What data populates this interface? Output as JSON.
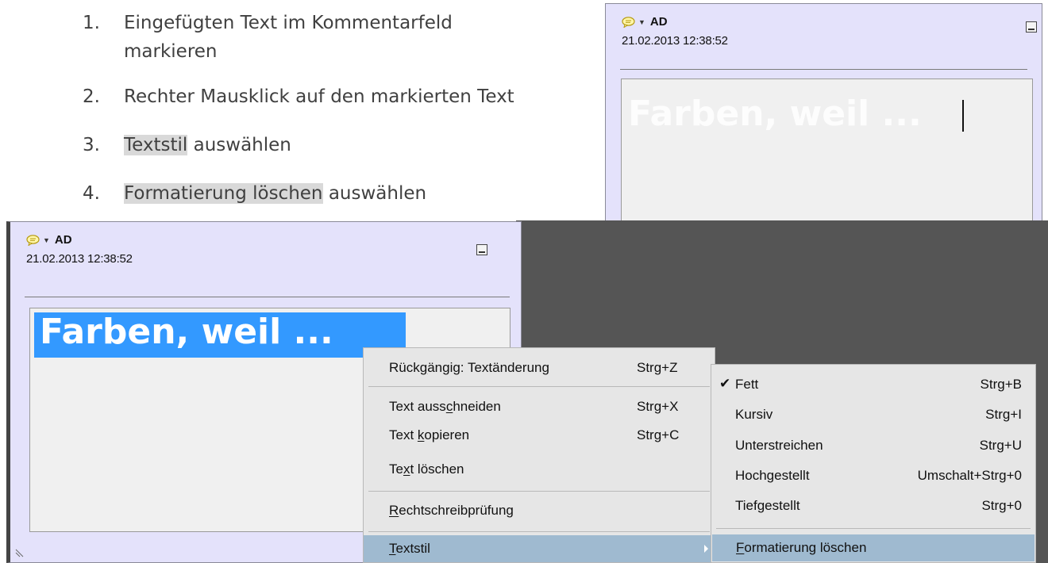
{
  "instructions": {
    "steps": [
      {
        "number": "1.",
        "text_line1": "Eingefügten Text im Kommentarfeld",
        "text_line2": "markieren"
      },
      {
        "number": "2.",
        "text": "Rechter Mausklick auf den markierten Text"
      },
      {
        "number": "3.",
        "highlight": "Textstil",
        "rest": " auswählen"
      },
      {
        "number": "4.",
        "highlight": "Formatierung löschen",
        "rest": " auswählen"
      }
    ]
  },
  "comment_after": {
    "author": "AD",
    "date": "21.02.2013 12:38:52",
    "text": "Farben, weil ..."
  },
  "comment_before": {
    "author": "AD",
    "date": "21.02.2013 12:38:52",
    "text": "Farben, weil ..."
  },
  "context_menu": {
    "items": [
      {
        "pre": "Rück",
        "u": "g",
        "post": "ängig: Textänderung",
        "shortcut": "Strg+Z"
      },
      {
        "pre": "Text auss",
        "u": "c",
        "post": "hneiden",
        "shortcut": "Strg+X"
      },
      {
        "pre": "Text ",
        "u": "k",
        "post": "opieren",
        "shortcut": "Strg+C"
      },
      {
        "pre": "Te",
        "u": "x",
        "post": "t löschen",
        "shortcut": ""
      },
      {
        "pre": "",
        "u": "R",
        "post": "echtschreibprüfung",
        "shortcut": ""
      },
      {
        "pre": "",
        "u": "T",
        "post": "extstil",
        "shortcut": ""
      }
    ]
  },
  "submenu": {
    "items": [
      {
        "label": "Fett",
        "shortcut": "Strg+B",
        "checked": "✔"
      },
      {
        "label": "Kursiv",
        "shortcut": "Strg+I"
      },
      {
        "label": "Unterstreichen",
        "shortcut": "Strg+U"
      },
      {
        "label": "Hochgestellt",
        "shortcut": "Umschalt+Strg+0"
      },
      {
        "label": "Tiefgestellt",
        "shortcut": "Strg+0"
      },
      {
        "pre": "",
        "u": "F",
        "post": "ormatierung löschen",
        "shortcut": ""
      }
    ]
  },
  "colors": {
    "selection": "#3399ff",
    "menu_highlight": "#9fbad0",
    "popup_background": "#e4e2fb"
  }
}
